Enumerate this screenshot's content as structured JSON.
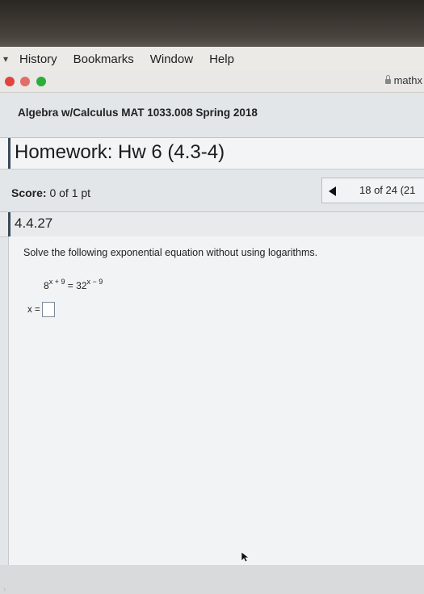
{
  "menubar": {
    "items": [
      "History",
      "Bookmarks",
      "Window",
      "Help"
    ]
  },
  "browser": {
    "url_text": "mathx"
  },
  "page": {
    "course_title": "Algebra w/Calculus MAT 1033.008 Spring 2018",
    "homework_title": "Homework: Hw 6 (4.3-4)",
    "score_label": "Score:",
    "score_value": "0 of 1 pt",
    "question_count": "18 of 24 (21",
    "question_number": "4.4.27",
    "instruction": "Solve the following exponential equation without using logarithms.",
    "equation": {
      "base_left": "8",
      "exp_left": "x + 9",
      "equals": " = ",
      "base_right": "32",
      "exp_right": "x − 9"
    },
    "answer_prefix": "x ="
  },
  "colors": {
    "close_dot": "#e0443e",
    "maximize_dot": "#2aae3b",
    "header_stripe": "#3a4a5a"
  },
  "icons": [
    "apple-icon",
    "lock-icon",
    "previous-arrow-icon",
    "mouse-pointer-icon"
  ]
}
